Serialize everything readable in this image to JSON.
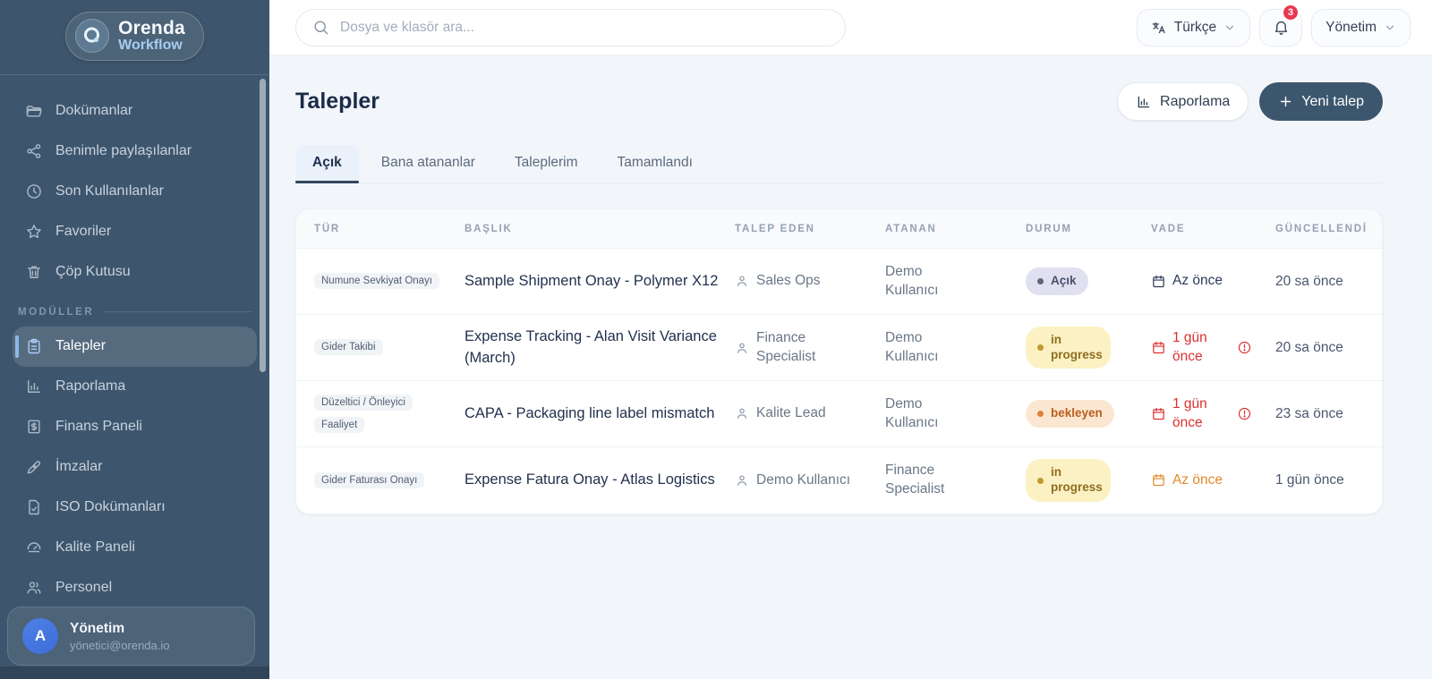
{
  "brand": {
    "line1": "Orenda",
    "line2": "Workflow"
  },
  "topbar": {
    "search_placeholder": "Dosya ve klasör ara...",
    "language_label": "Türkçe",
    "notifications_count": "3",
    "user_menu_label": "Yönetim"
  },
  "sidebar": {
    "nav": [
      {
        "label": "Dokümanlar",
        "icon": "folder"
      },
      {
        "label": "Benimle paylaşılanlar",
        "icon": "share"
      },
      {
        "label": "Son Kullanılanlar",
        "icon": "clock"
      },
      {
        "label": "Favoriler",
        "icon": "star"
      },
      {
        "label": "Çöp Kutusu",
        "icon": "trash"
      }
    ],
    "section_label": "MODÜLLER",
    "modules": [
      {
        "label": "Talepler",
        "icon": "clipboard",
        "active": true
      },
      {
        "label": "Raporlama",
        "icon": "bar-chart"
      },
      {
        "label": "Finans Paneli",
        "icon": "finance"
      },
      {
        "label": "İmzalar",
        "icon": "pen"
      },
      {
        "label": "ISO Dokümanları",
        "icon": "file-check"
      },
      {
        "label": "Kalite Paneli",
        "icon": "gauge"
      },
      {
        "label": "Personel",
        "icon": "users"
      }
    ],
    "user": {
      "initial": "A",
      "name": "Yönetim",
      "email": "yönetici@orenda.io"
    }
  },
  "page": {
    "title": "Talepler",
    "actions": {
      "report": "Raporlama",
      "new_request": "Yeni talep"
    },
    "tabs": [
      {
        "label": "Açık",
        "active": true
      },
      {
        "label": "Bana atananlar"
      },
      {
        "label": "Taleplerim"
      },
      {
        "label": "Tamamlandı"
      }
    ],
    "table": {
      "columns": [
        "TÜR",
        "BAŞLIK",
        "TALEP EDEN",
        "ATANAN",
        "DURUM",
        "VADE",
        "GÜNCELLENDİ"
      ],
      "rows": [
        {
          "type": "Numune Sevkiyat Onayı",
          "title": "Sample Shipment Onay - Polymer X12",
          "requester": "Sales Ops",
          "assignee": "Demo Kullanıcı",
          "status": "Açık",
          "due": "Az önce",
          "updated": "20 sa önce"
        },
        {
          "type": "Gider Takibi",
          "title": "Expense Tracking - Alan Visit Variance (March)",
          "requester": "Finance Specialist",
          "assignee": "Demo Kullanıcı",
          "status": "in progress",
          "due": "1 gün önce",
          "updated": "20 sa önce"
        },
        {
          "type": "Düzeltici / Önleyici Faaliyet",
          "title": "CAPA - Packaging line label mismatch",
          "requester": "Kalite Lead",
          "assignee": "Demo Kullanıcı",
          "status": "bekleyen",
          "due": "1 gün önce",
          "updated": "23 sa önce"
        },
        {
          "type": "Gider Faturası Onayı",
          "title": "Expense Fatura Onay - Atlas Logistics",
          "requester": "Demo Kullanıcı",
          "assignee": "Finance Specialist",
          "status": "in progress",
          "due": "Az önce",
          "updated": "1 gün önce"
        }
      ]
    }
  },
  "colors": {
    "sidebar_bg": "#3E566D",
    "accent_blue": "#8CB8E9",
    "primary_button": "#3C566E",
    "badge_red": "#E8384F",
    "status_open_bg": "#E1E0F0",
    "status_progress_bg": "#FCF1C3",
    "status_pending_bg": "#FBE7D1",
    "overdue_red": "#DC3030",
    "warn_orange": "#E08A2B"
  }
}
